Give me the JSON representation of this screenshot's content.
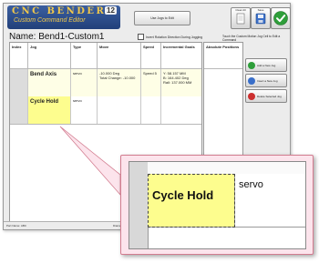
{
  "app": {
    "logo_title": "CNC BENDER",
    "logo_number": "12",
    "logo_subtitle": "Custom Command Editor",
    "jog_button": "Use Jogs to Edit",
    "name_label": "Name: Bend1-Custom1",
    "invert_label": "Invert Rotation Direction During Jogging",
    "touch_hint": "Touch the Custom Motion Jog Cell to Edit a Command",
    "icons": {
      "clear": {
        "label": "Clear All",
        "icon": "page-icon"
      },
      "save": {
        "label": "Save",
        "icon": "disk-icon"
      },
      "ok": {
        "icon": "check-icon",
        "color": "#2e9e3a"
      }
    }
  },
  "table": {
    "headers": [
      "Index",
      "Jog",
      "Type",
      "Move",
      "Speed",
      "Incremental Goals"
    ],
    "rows": [
      {
        "jog": "Bend Axis",
        "type": "servo",
        "move": [
          "-10.000 Deg",
          "Total Change: -10.000"
        ],
        "speed": "Speed 5",
        "goals": [
          "Y: 58.157 MM",
          "B: 164.402 Deg",
          "Rall: 137.000 MM"
        ]
      },
      {
        "jog": "Cycle Hold",
        "type": "servo",
        "move": [],
        "speed": "",
        "goals": []
      }
    ]
  },
  "absolute": {
    "header": "Absolute Positions"
  },
  "side_buttons": [
    {
      "label": "Add a New Jog",
      "icon": "add-icon",
      "color": "#2e9e3a"
    },
    {
      "label": "Insert a New Jog",
      "icon": "insert-icon",
      "color": "#3a6fc9"
    },
    {
      "label": "Delete Selected Jog",
      "icon": "delete-icon",
      "color": "#cc2f2f"
    }
  ],
  "status": {
    "part_name": "Part Name: ABC",
    "diameter": "Diameter: 50.000"
  },
  "zoom": {
    "jog": "Cycle Hold",
    "type": "servo"
  },
  "colors": {
    "selected_cell": "#fdfd8e",
    "callout_bg": "#fce4ec",
    "logo_bg": "#2d4f8e",
    "logo_text": "#f2c84a"
  }
}
